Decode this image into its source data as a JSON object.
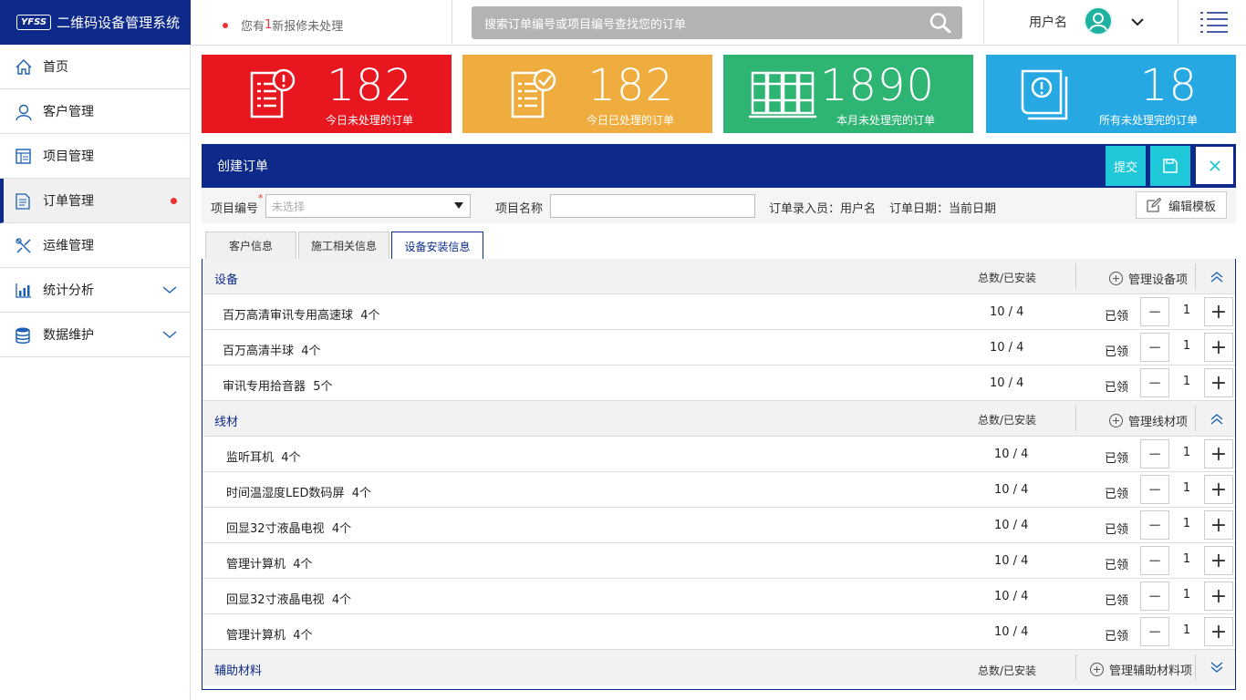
{
  "app": {
    "logo_mark": "YFSS",
    "title": "二维码设备管理系统"
  },
  "notice": {
    "prefix": "您有",
    "count": "1",
    "suffix": "新报修未处理"
  },
  "search": {
    "placeholder": "搜索订单编号或项目编号查找您的订单",
    "icon": "search-icon"
  },
  "user": {
    "name": "用户名",
    "avatar_color": "#1fb2a0"
  },
  "nav": [
    {
      "label": "首页",
      "icon": "home-icon"
    },
    {
      "label": "客户管理",
      "icon": "user-icon"
    },
    {
      "label": "项目管理",
      "icon": "project-icon"
    },
    {
      "label": "订单管理",
      "icon": "order-icon",
      "active": true,
      "badge": true
    },
    {
      "label": "运维管理",
      "icon": "tools-icon"
    },
    {
      "label": "统计分析",
      "icon": "chart-icon",
      "expandable": true
    },
    {
      "label": "数据维护",
      "icon": "database-icon",
      "expandable": true
    }
  ],
  "cards": [
    {
      "value": "182",
      "label": "今日未处理的订单",
      "color": "#e8171f"
    },
    {
      "value": "182",
      "label": "今日已处理的订单",
      "color": "#f0ad3f"
    },
    {
      "value": "1890",
      "label": "本月未处理完的订单",
      "color": "#2eb473"
    },
    {
      "value": "18",
      "label": "所有未处理完的订单",
      "color": "#26a9e3"
    }
  ],
  "panel": {
    "title": "创建订单",
    "submit_label": "提交",
    "save_icon": "save-icon",
    "close_icon": "close-icon"
  },
  "form": {
    "project_no_label": "项目编号",
    "required_mark": "*",
    "project_no_placeholder": "未选择",
    "project_name_label": "项目名称",
    "recorder": "订单录入员：用户名",
    "date": "订单日期：当前日期",
    "template_label": "编辑模板"
  },
  "tabs": [
    {
      "label": "客户信息"
    },
    {
      "label": "施工相关信息"
    },
    {
      "label": "设备安装信息",
      "active": true
    }
  ],
  "sections": [
    {
      "title": "设备",
      "total_header": "总数/已安装",
      "manage_label": "管理设备项",
      "items": [
        {
          "name": "百万高清审讯专用高速球",
          "count": "4个",
          "qty": "10 / 4",
          "status": "已领",
          "value": "1"
        },
        {
          "name": "百万高清半球",
          "count": "4个",
          "qty": "10 / 4",
          "status": "已领",
          "value": "1"
        },
        {
          "name": "审讯专用拾音器",
          "count": "5个",
          "qty": "10 / 4",
          "status": "已领",
          "value": "1"
        }
      ]
    },
    {
      "title": "线材",
      "total_header": "总数/已安装",
      "manage_label": "管理线材项",
      "items": [
        {
          "name": "监听耳机",
          "count": "4个",
          "qty": "10 / 4",
          "status": "已领",
          "value": "1"
        },
        {
          "name": "时间温湿度LED数码屏",
          "count": "4个",
          "qty": "10 / 4",
          "status": "已领",
          "value": "1"
        },
        {
          "name": "回显32寸液晶电视",
          "count": "4个",
          "qty": "10 / 4",
          "status": "已领",
          "value": "1"
        },
        {
          "name": "管理计算机",
          "count": "4个",
          "qty": "10 / 4",
          "status": "已领",
          "value": "1"
        },
        {
          "name": "回显32寸液晶电视",
          "count": "4个",
          "qty": "10 / 4",
          "status": "已领",
          "value": "1"
        },
        {
          "name": "管理计算机",
          "count": "4个",
          "qty": "10 / 4",
          "status": "已领",
          "value": "1"
        }
      ]
    },
    {
      "title": "辅助材料",
      "total_header": "总数/已安装",
      "manage_label": "管理辅助材料项",
      "collapsed": true,
      "items": []
    }
  ]
}
